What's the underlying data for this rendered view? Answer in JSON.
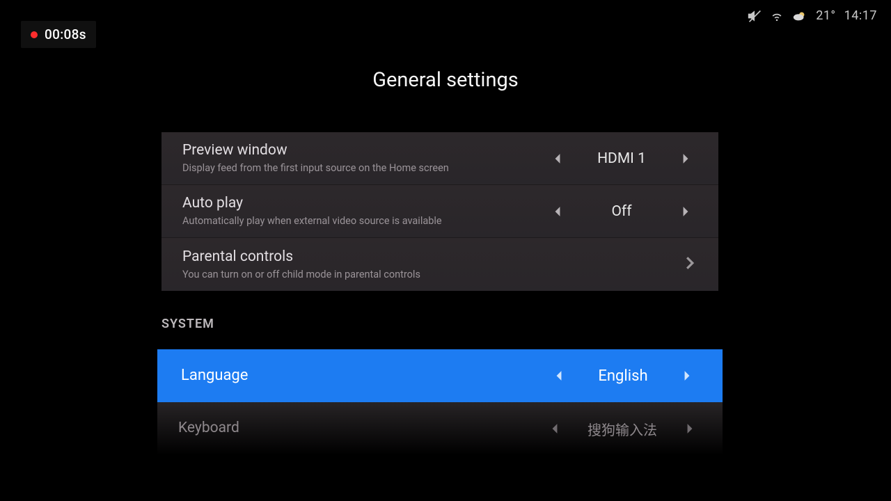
{
  "recording": {
    "elapsed": "00:08s"
  },
  "status": {
    "temperature": "21°",
    "time": "14:17"
  },
  "title": "General settings",
  "rows": {
    "preview": {
      "title": "Preview window",
      "sub": "Display feed from the first input source on the Home screen",
      "value": "HDMI 1"
    },
    "autoplay": {
      "title": "Auto play",
      "sub": "Automatically play when external video source is available",
      "value": "Off"
    },
    "parental": {
      "title": "Parental controls",
      "sub": "You can turn on or off child mode in parental controls"
    }
  },
  "section_system": "SYSTEM",
  "system": {
    "language": {
      "title": "Language",
      "value": "English"
    },
    "keyboard": {
      "title": "Keyboard",
      "value": "搜狗输入法"
    }
  }
}
